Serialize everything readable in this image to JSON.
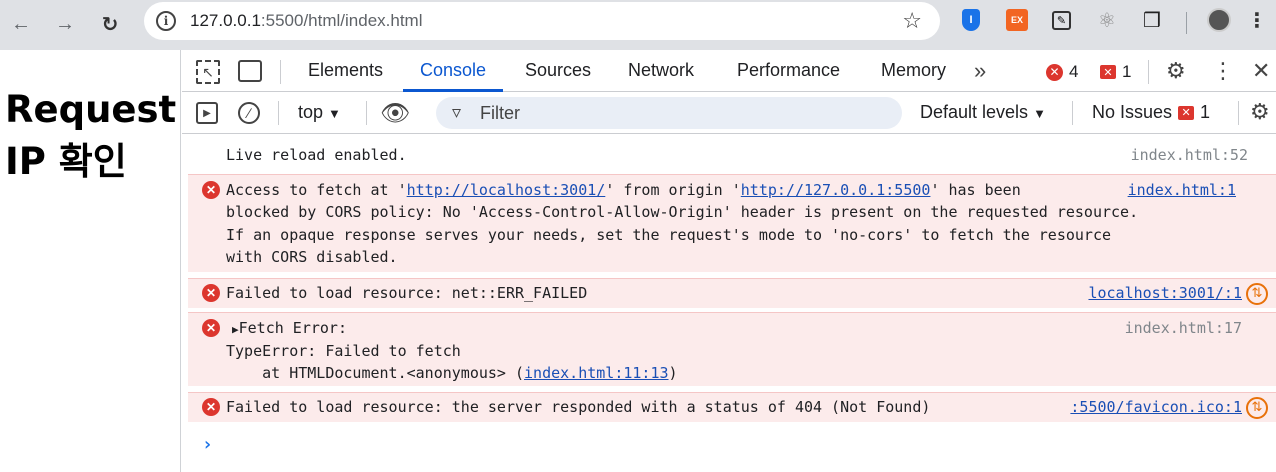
{
  "browser": {
    "url_host": "127.0.0.1",
    "url_rest": ":5500/html/index.html",
    "ext_ex_label": "EX"
  },
  "page": {
    "heading_line1": "Request",
    "heading_line2": "IP 확인"
  },
  "devtools": {
    "tabs": [
      "Elements",
      "Console",
      "Sources",
      "Network",
      "Performance",
      "Memory"
    ],
    "active_tab": "Console",
    "error_count": "4",
    "issue_count": "1",
    "context": "top",
    "filter_placeholder": "Filter",
    "levels": "Default levels",
    "no_issues": "No Issues",
    "no_issues_count": "1"
  },
  "messages": [
    {
      "type": "log",
      "text": "Live reload enabled.",
      "source": "index.html:52"
    },
    {
      "type": "error",
      "line1_a": "Access to fetch at '",
      "line1_link1": "http://localhost:3001/",
      "line1_b": "' from origin '",
      "line1_link2": "http://127.0.0.1:5500",
      "line1_c": "' has been",
      "line2": "blocked by CORS policy: No 'Access-Control-Allow-Origin' header is present on the requested resource.",
      "line3": "If an opaque response serves your needs, set the request's mode to 'no-cors' to fetch the resource",
      "line4": "with CORS disabled.",
      "source": "index.html:1"
    },
    {
      "type": "error",
      "text": "Failed to load resource: net::ERR_FAILED",
      "source": "localhost:3001/:1"
    },
    {
      "type": "error",
      "line1": "Fetch Error:",
      "line2": "TypeError: Failed to fetch",
      "line3_a": "    at HTMLDocument.<anonymous> (",
      "line3_link": "index.html:11:13",
      "line3_b": ")",
      "source": "index.html:17"
    },
    {
      "type": "error",
      "text": "Failed to load resource: the server responded with a status of 404 (Not Found)",
      "source": ":5500/favicon.ico:1"
    }
  ],
  "colors": {
    "error": "#dc362e",
    "accent": "#0b57d0",
    "network": "#e8710a"
  }
}
